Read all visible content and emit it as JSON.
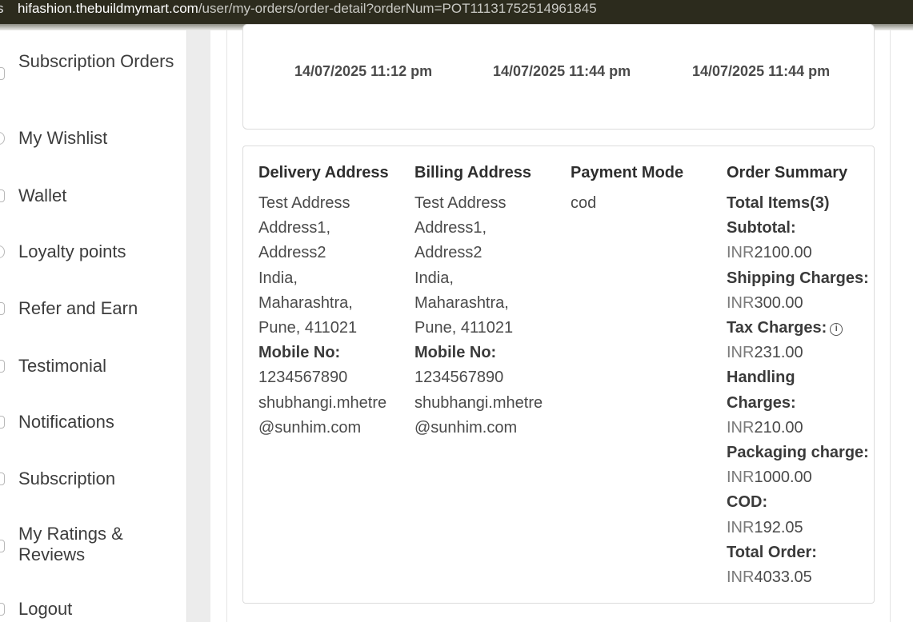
{
  "browser": {
    "url_host": "hifashion.thebuildmymart.com",
    "url_path": "/user/my-orders/order-detail?orderNum=POT11131752514961845",
    "url_lead": "s"
  },
  "sidebar": {
    "items": [
      {
        "label": "Subscription Orders",
        "icon": "subscription-orders-icon"
      },
      {
        "label": "My Wishlist",
        "icon": "heart-icon"
      },
      {
        "label": "Wallet",
        "icon": "wallet-icon"
      },
      {
        "label": "Loyalty points",
        "icon": "loyalty-icon"
      },
      {
        "label": "Refer and Earn",
        "icon": "refer-icon"
      },
      {
        "label": "Testimonial",
        "icon": "testimonial-icon"
      },
      {
        "label": "Notifications",
        "icon": "bell-icon"
      },
      {
        "label": "Subscription",
        "icon": "subscription-icon"
      },
      {
        "label": "My Ratings & Reviews",
        "icon": "star-icon"
      },
      {
        "label": "Logout",
        "icon": "logout-icon"
      }
    ]
  },
  "status": {
    "dates": [
      "14/07/2025 11:12 pm",
      "14/07/2025 11:44 pm",
      "14/07/2025 11:44 pm"
    ]
  },
  "delivery": {
    "title": "Delivery Address",
    "lines": [
      "Test Address",
      "Address1,",
      "Address2",
      "India,",
      "Maharashtra,",
      "Pune, 411021"
    ],
    "mobile_label": "Mobile No:",
    "mobile": "1234567890",
    "email_1": "shubhangi.mhetre",
    "email_2": "@sunhim.com"
  },
  "billing": {
    "title": "Billing Address",
    "lines": [
      "Test Address",
      "Address1,",
      "Address2",
      "India,",
      "Maharashtra,",
      "Pune, 411021"
    ],
    "mobile_label": "Mobile No:",
    "mobile": "1234567890",
    "email_1": "shubhangi.mhetre",
    "email_2": "@sunhim.com"
  },
  "payment": {
    "title": "Payment Mode",
    "mode": "cod"
  },
  "summary": {
    "title": "Order Summary",
    "total_items": "Total Items(3)",
    "currency": "INR",
    "subtotal_label": "Subtotal:",
    "subtotal": "2100.00",
    "shipping_label": "Shipping Charges:",
    "shipping": "300.00",
    "tax_label": "Tax Charges:",
    "tax": "231.00",
    "handling_label_1": "Handling",
    "handling_label_2": "Charges:",
    "handling": "210.00",
    "packaging_label": "Packaging charge:",
    "packaging": "1000.00",
    "cod_label": "COD:",
    "cod": "192.05",
    "total_label": "Total Order:",
    "total": "4033.05"
  }
}
